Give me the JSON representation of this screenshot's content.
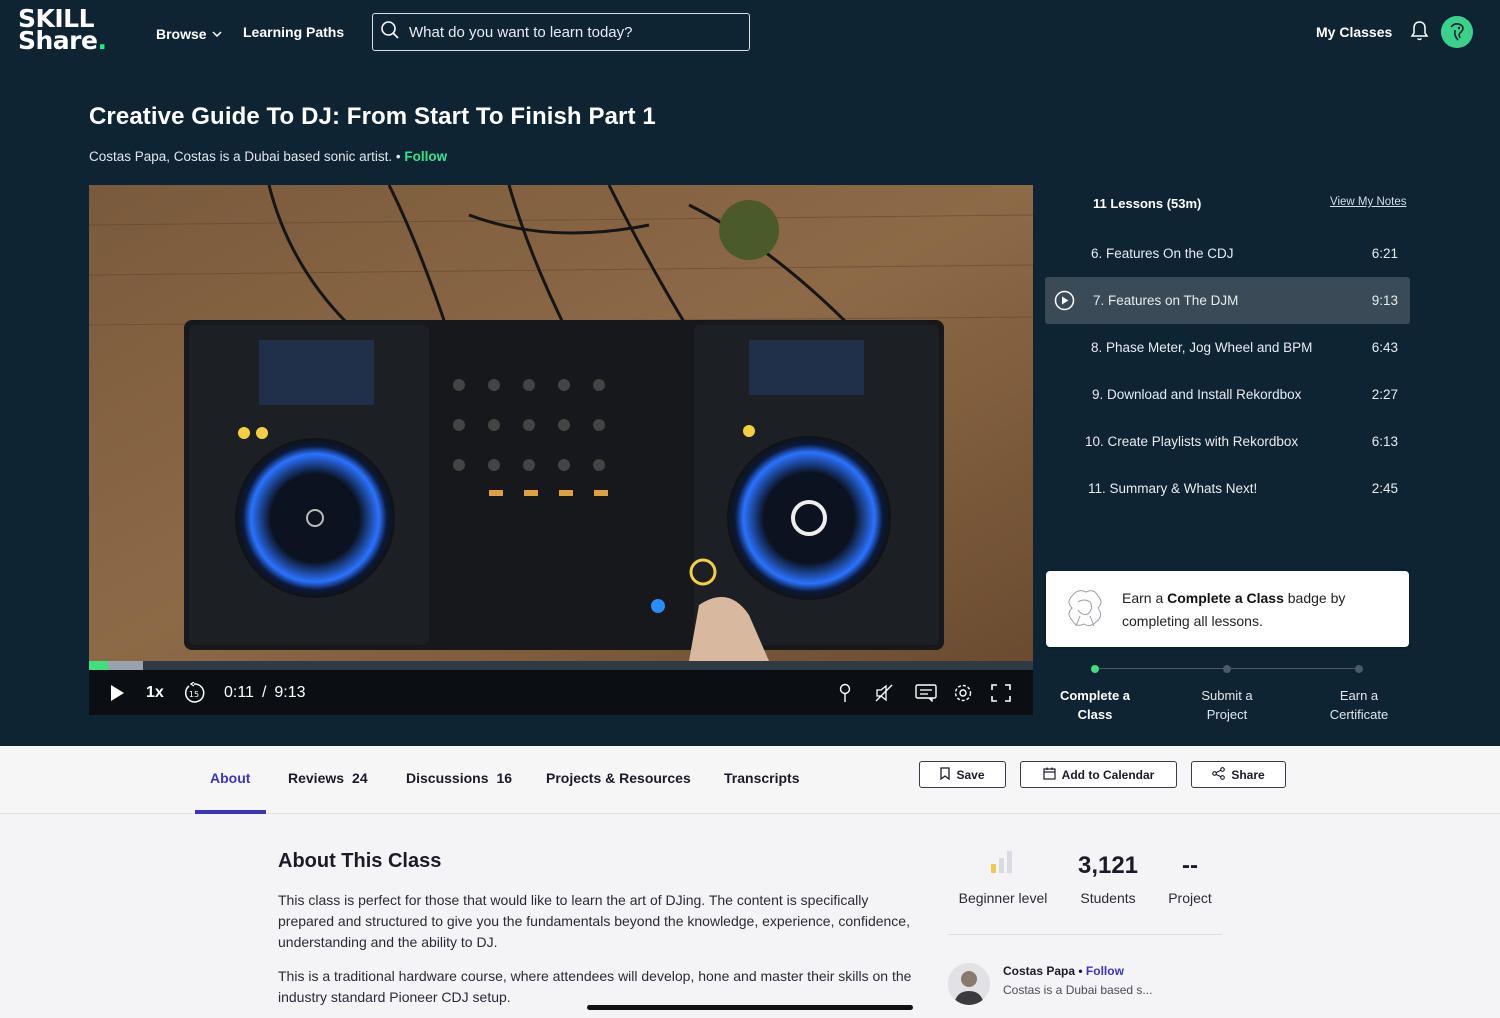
{
  "header": {
    "logo_line1": "SKILL",
    "logo_line2": "Share",
    "logo_dot": ".",
    "nav": {
      "browse": "Browse",
      "learning_paths": "Learning Paths"
    },
    "search_placeholder": "What do you want to learn today?",
    "my_classes": "My Classes"
  },
  "class": {
    "title": "Creative Guide To DJ: From Start To Finish Part 1",
    "byline": "Costas Papa, Costas is a Dubai based sonic artist.",
    "separator": "•",
    "follow": "Follow"
  },
  "player": {
    "speed": "1x",
    "current_time": "0:11",
    "time_sep": "/",
    "duration": "9:13",
    "played_fraction": 0.02,
    "buffered_fraction": 0.057
  },
  "lessons": {
    "header": "11 Lessons (53m)",
    "view_notes": "View My Notes",
    "items": [
      {
        "title": "6. Features On the CDJ",
        "duration": "6:21",
        "active": false
      },
      {
        "title": "7. Features on The DJM",
        "duration": "9:13",
        "active": true
      },
      {
        "title": "8. Phase Meter, Jog Wheel and BPM",
        "duration": "6:43",
        "active": false
      },
      {
        "title": "9. Download and Install Rekordbox",
        "duration": "2:27",
        "active": false
      },
      {
        "title": "10. Create Playlists with Rekordbox",
        "duration": "6:13",
        "active": false
      },
      {
        "title": "11. Summary & Whats Next!",
        "duration": "2:45",
        "active": false
      }
    ]
  },
  "badge": {
    "prefix": "Earn a ",
    "bold": "Complete a Class",
    "suffix": " badge by completing all lessons."
  },
  "steps": [
    {
      "line1": "Complete a",
      "line2": "Class",
      "active": true
    },
    {
      "line1": "Submit a",
      "line2": "Project",
      "active": false
    },
    {
      "line1": "Earn a",
      "line2": "Certificate",
      "active": false
    }
  ],
  "tabs": {
    "about": "About",
    "reviews": "Reviews",
    "reviews_count": "24",
    "discussions": "Discussions",
    "discussions_count": "16",
    "projects": "Projects & Resources",
    "transcripts": "Transcripts"
  },
  "actions": {
    "save": "Save",
    "calendar": "Add to Calendar",
    "share": "Share"
  },
  "about": {
    "heading": "About This Class",
    "p1": "This class is perfect for those that would like to learn the art of DJing. The content is specifically prepared and structured to give you the fundamentals beyond the knowledge, experience, confidence, understanding and the ability to DJ.",
    "p2": "This is a traditional hardware course, where attendees will develop, hone and master their skills on the industry standard Pioneer CDJ setup."
  },
  "stats": {
    "level": "Beginner level",
    "students_num": "3,121",
    "students_label": "Students",
    "project_num": "--",
    "project_label": "Project"
  },
  "teacher": {
    "name": "Costas Papa",
    "separator": "•",
    "follow": "Follow",
    "desc": "Costas is a Dubai based s..."
  },
  "colors": {
    "hero_bg": "#0e2433",
    "accent_green": "#3ee07f",
    "tab_accent": "#3b34c3"
  }
}
